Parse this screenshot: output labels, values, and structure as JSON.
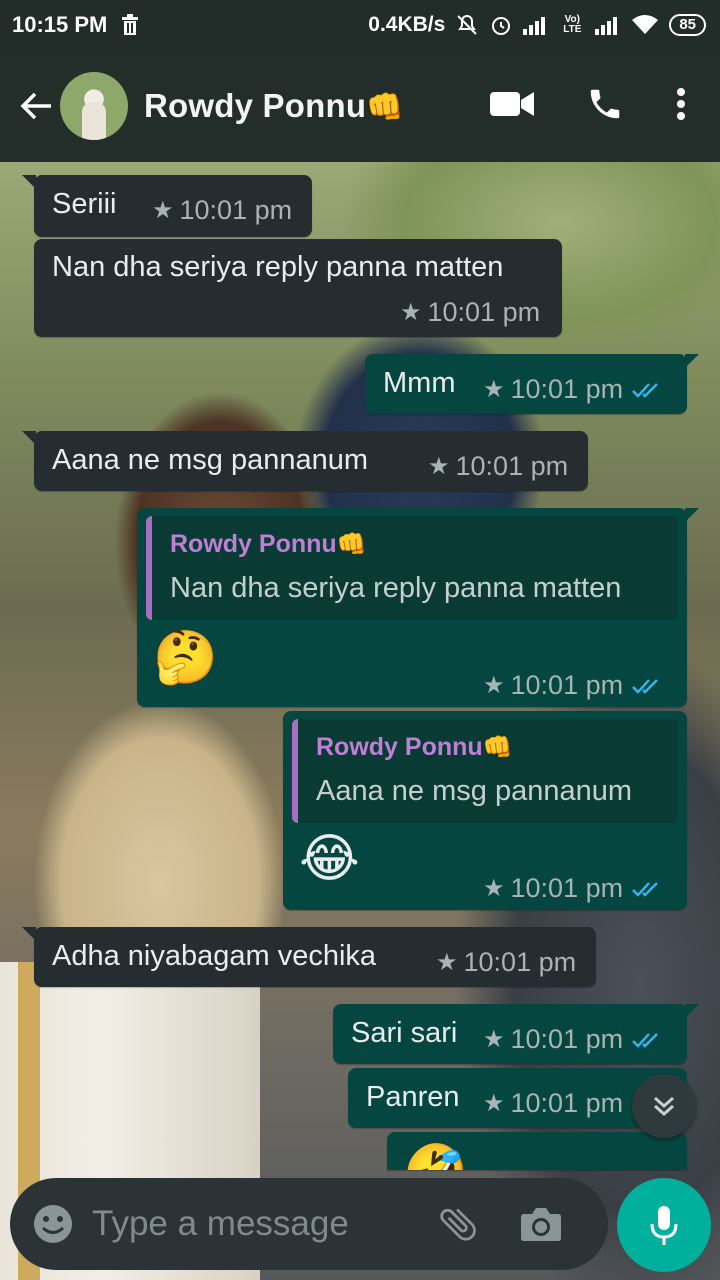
{
  "status_bar": {
    "time": "10:15 PM",
    "speed": "0.4KB/s",
    "battery": "85",
    "lte_label": "Vo) LTE"
  },
  "header": {
    "contact_name": "Rowdy Ponnu",
    "name_emoji": "👊"
  },
  "messages": [
    {
      "direction": "in",
      "text": "Seriii",
      "time": "10:01 pm",
      "starred": true
    },
    {
      "direction": "in",
      "text": "Nan dha seriya reply panna matten",
      "time": "10:01 pm",
      "starred": true
    },
    {
      "direction": "out",
      "text": "Mmm",
      "time": "10:01 pm",
      "starred": true,
      "read": true
    },
    {
      "direction": "in",
      "text": "Aana ne msg pannanum",
      "time": "10:01 pm",
      "starred": true
    },
    {
      "direction": "out",
      "quote_name": "Rowdy Ponnu",
      "quote_emoji": "👊",
      "quote_text": "Nan dha seriya reply panna matten",
      "emoji": "🤔",
      "time": "10:01 pm",
      "starred": true,
      "read": true
    },
    {
      "direction": "out",
      "quote_name": "Rowdy Ponnu",
      "quote_emoji": "👊",
      "quote_text": "Aana ne msg pannanum",
      "emoji": "😂",
      "time": "10:01 pm",
      "starred": true,
      "read": true
    },
    {
      "direction": "in",
      "text": "Adha niyabagam vechika",
      "time": "10:01 pm",
      "starred": true
    },
    {
      "direction": "out",
      "text": "Sari sari",
      "time": "10:01 pm",
      "starred": true,
      "read": true
    },
    {
      "direction": "out",
      "text": "Panren",
      "time": "10:01 pm",
      "starred": true,
      "read": true
    },
    {
      "direction": "out",
      "emoji": "🤣",
      "partial": true
    }
  ],
  "composer": {
    "placeholder": "Type a message"
  },
  "icons": {
    "back": "arrow-left-icon",
    "video": "video-call-icon",
    "call": "phone-icon",
    "menu": "more-vert-icon",
    "emoji": "emoji-icon",
    "attach": "paperclip-icon",
    "camera": "camera-icon",
    "mic": "mic-icon",
    "scroll": "double-chevron-down-icon"
  },
  "colors": {
    "incoming_bubble": "#262d31",
    "outgoing_bubble": "#054740",
    "quote_name": "#c07fd6",
    "read_ticks": "#34b7f1",
    "mic_button": "#00af9c"
  }
}
